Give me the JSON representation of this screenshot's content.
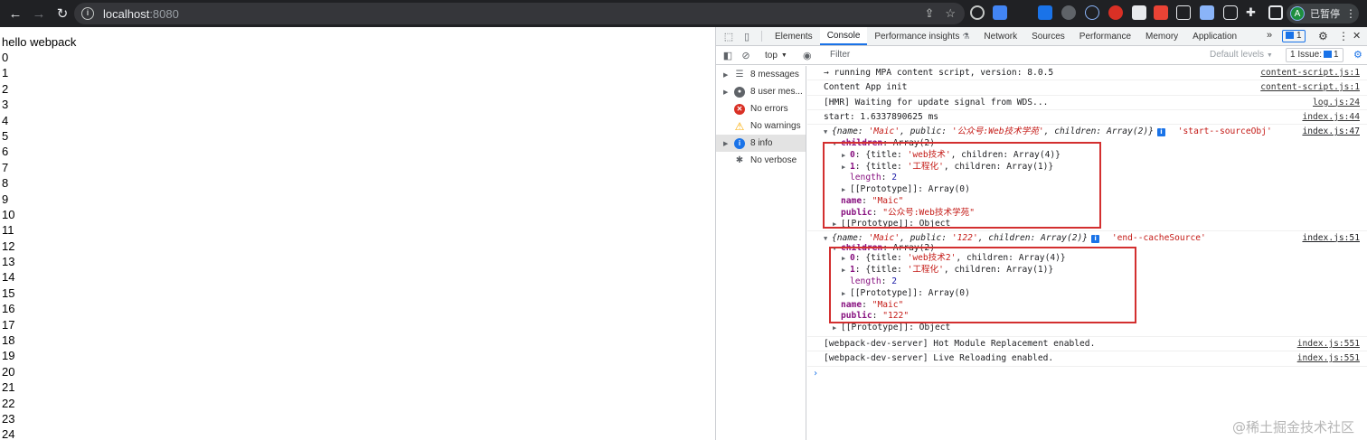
{
  "browser": {
    "url_host": "localhost",
    "url_port": ":8080",
    "profile_initial": "A",
    "profile_label": "已暂停"
  },
  "page": {
    "heading": "hello webpack",
    "numbers": [
      "0",
      "1",
      "2",
      "3",
      "4",
      "5",
      "6",
      "7",
      "8",
      "9",
      "10",
      "11",
      "12",
      "13",
      "14",
      "15",
      "16",
      "17",
      "18",
      "19",
      "20",
      "21",
      "22",
      "23",
      "24"
    ]
  },
  "devtools": {
    "tabs": [
      "Elements",
      "Console",
      "Performance insights",
      "Network",
      "Sources",
      "Performance",
      "Memory",
      "Application"
    ],
    "active_tab": "Console",
    "message_count": "1",
    "toolbar": {
      "context": "top",
      "filter_placeholder": "Filter",
      "levels": "Default levels",
      "issues": "1 Issue:",
      "issues_count": "1"
    },
    "sidebar": [
      {
        "label": "8 messages",
        "icon": "list-icon",
        "arrow": true
      },
      {
        "label": "8 user mes...",
        "icon": "user-icon",
        "arrow": true
      },
      {
        "label": "No errors",
        "icon": "error-icon",
        "arrow": false
      },
      {
        "label": "No warnings",
        "icon": "warning-icon",
        "arrow": false
      },
      {
        "label": "8 info",
        "icon": "info-icon",
        "arrow": true,
        "selected": true
      },
      {
        "label": "No verbose",
        "icon": "bug-icon",
        "arrow": false
      }
    ],
    "console": {
      "l1": {
        "text": "→ running MPA content script, version: 8.0.5",
        "src": "content-script.js:1"
      },
      "l2": {
        "text": "Content App init",
        "src": "content-script.js:1"
      },
      "l3": {
        "text": "[HMR] Waiting for update signal from WDS...",
        "src": "log.js:24"
      },
      "l4": {
        "text": "start: 1.6337890625 ms",
        "src": "index.js:44"
      },
      "obj1": {
        "summary_open": "{name: ",
        "name": "'Maic'",
        "sep1": ", public: ",
        "public": "'公众号:Web技术学苑'",
        "sep2": ", children: Array(2)}",
        "label": "'start--sourceObj'",
        "src": "index.js:47",
        "children_key": "children",
        "children_val": ": Array(2)",
        "c0_key": "0",
        "c0_a": ": {title: ",
        "c0_title": "'web技术'",
        "c0_b": ", children: Array(4)}",
        "c1_key": "1",
        "c1_a": ": {title: ",
        "c1_title": "'工程化'",
        "c1_b": ", children: Array(1)}",
        "length_key": "length",
        "length_val": "2",
        "proto_arr": "[[Prototype]]: Array(0)",
        "name_key": "name",
        "name_val": "\"Maic\"",
        "public_key": "public",
        "public_val": "\"公众号:Web技术学苑\"",
        "proto_obj": "[[Prototype]]: Object"
      },
      "obj2": {
        "summary_open": "{name: ",
        "name": "'Maic'",
        "sep1": ", public: ",
        "public": "'122'",
        "sep2": ", children: Array(2)}",
        "label": "'end--cacheSource'",
        "src": "index.js:51",
        "children_key": "children",
        "children_val": ": Array(2)",
        "c0_key": "0",
        "c0_a": ": {title: ",
        "c0_title": "'web技术2'",
        "c0_b": ", children: Array(4)}",
        "c1_key": "1",
        "c1_a": ": {title: ",
        "c1_title": "'工程化'",
        "c1_b": ", children: Array(1)}",
        "length_key": "length",
        "length_val": "2",
        "proto_arr": "[[Prototype]]: Array(0)",
        "name_key": "name",
        "name_val": "\"Maic\"",
        "public_key": "public",
        "public_val": "\"122\"",
        "proto_obj": "[[Prototype]]: Object"
      },
      "l5": {
        "text": "[webpack-dev-server] Hot Module Replacement enabled.",
        "src": "index.js:551"
      },
      "l6": {
        "text": "[webpack-dev-server] Live Reloading enabled.",
        "src": "index.js:551"
      },
      "prompt": "›"
    }
  },
  "watermark": "@稀土掘金技术社区",
  "colors": {
    "highlight_box": "#d32f2f",
    "accent": "#1a73e8"
  }
}
